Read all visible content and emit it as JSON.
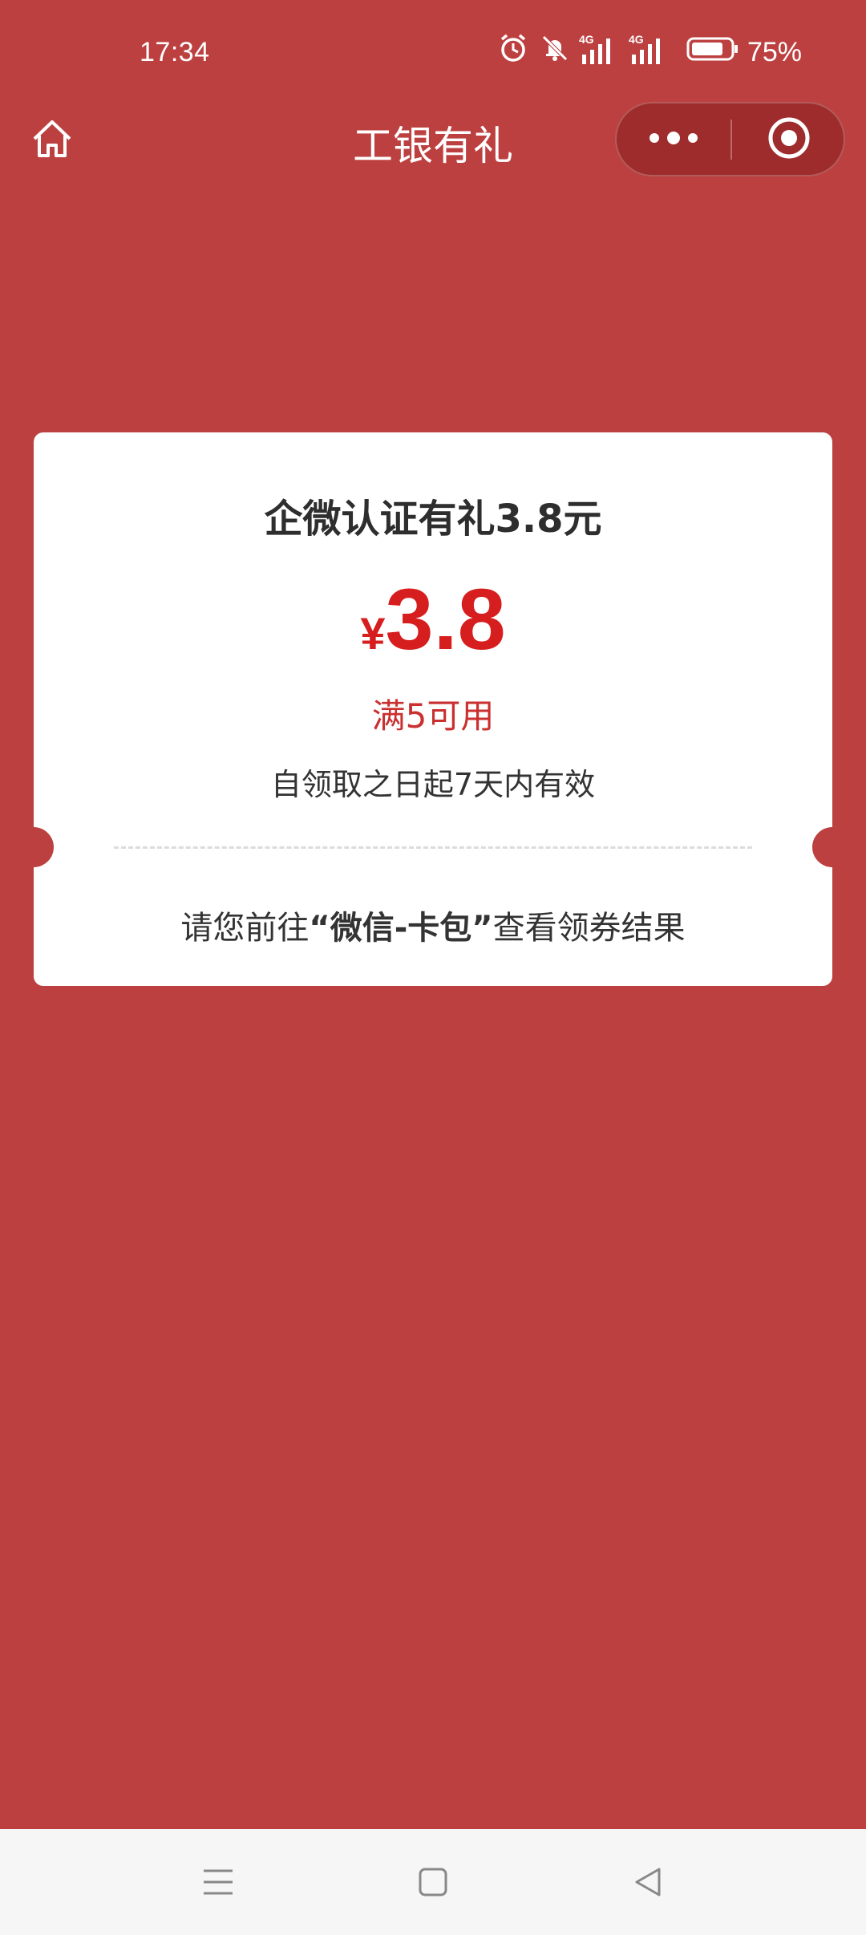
{
  "status_bar": {
    "time": "17:34",
    "battery_percent": "75%",
    "icons": [
      "alarm-icon",
      "mute-icon",
      "signal-4g-icon",
      "signal-4g-icon",
      "battery-icon"
    ]
  },
  "nav": {
    "title": "工银有礼",
    "home_icon": "home-icon",
    "more_icon": "more-dots-icon",
    "close_icon": "target-close-icon"
  },
  "coupon": {
    "title": "企微认证有礼3.8元",
    "currency_symbol": "¥",
    "amount": "3.8",
    "condition": "满5可用",
    "validity": "自领取之日起7天内有效",
    "hint_prefix": "请您前往",
    "hint_highlight": "“微信-卡包”",
    "hint_suffix": "查看领券结果"
  },
  "colors": {
    "background": "#bd4040",
    "amount_red": "#d71e1e",
    "card": "#ffffff"
  },
  "system_nav": {
    "icons": [
      "menu-icon",
      "home-square-icon",
      "back-triangle-icon"
    ]
  }
}
